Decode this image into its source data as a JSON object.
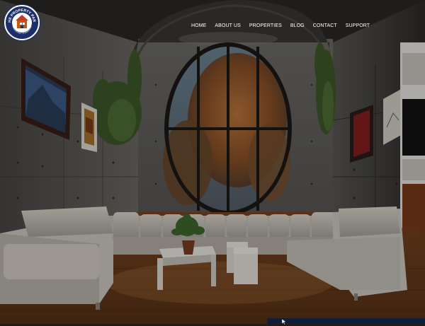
{
  "brand": {
    "logo_text": "THE PROPERTY PARK",
    "logo_subtext": "• RESIDENTIAL • COMMERCIAL •"
  },
  "nav": {
    "items": [
      {
        "label": "HOME"
      },
      {
        "label": "ABOUT US"
      },
      {
        "label": "PROPERTIES"
      },
      {
        "label": "BLOG"
      },
      {
        "label": "CONTACT"
      },
      {
        "label": "SUPPORT"
      }
    ]
  },
  "colors": {
    "brand_navy": "#1b2f6b",
    "wall_gray": "#6a6967",
    "floor_wood": "#8a4f24",
    "sofa_white": "#d9d4cc",
    "bottom_bar": "#0e1f3c"
  },
  "icons": [
    "house-logo-icon",
    "cursor-icon"
  ]
}
